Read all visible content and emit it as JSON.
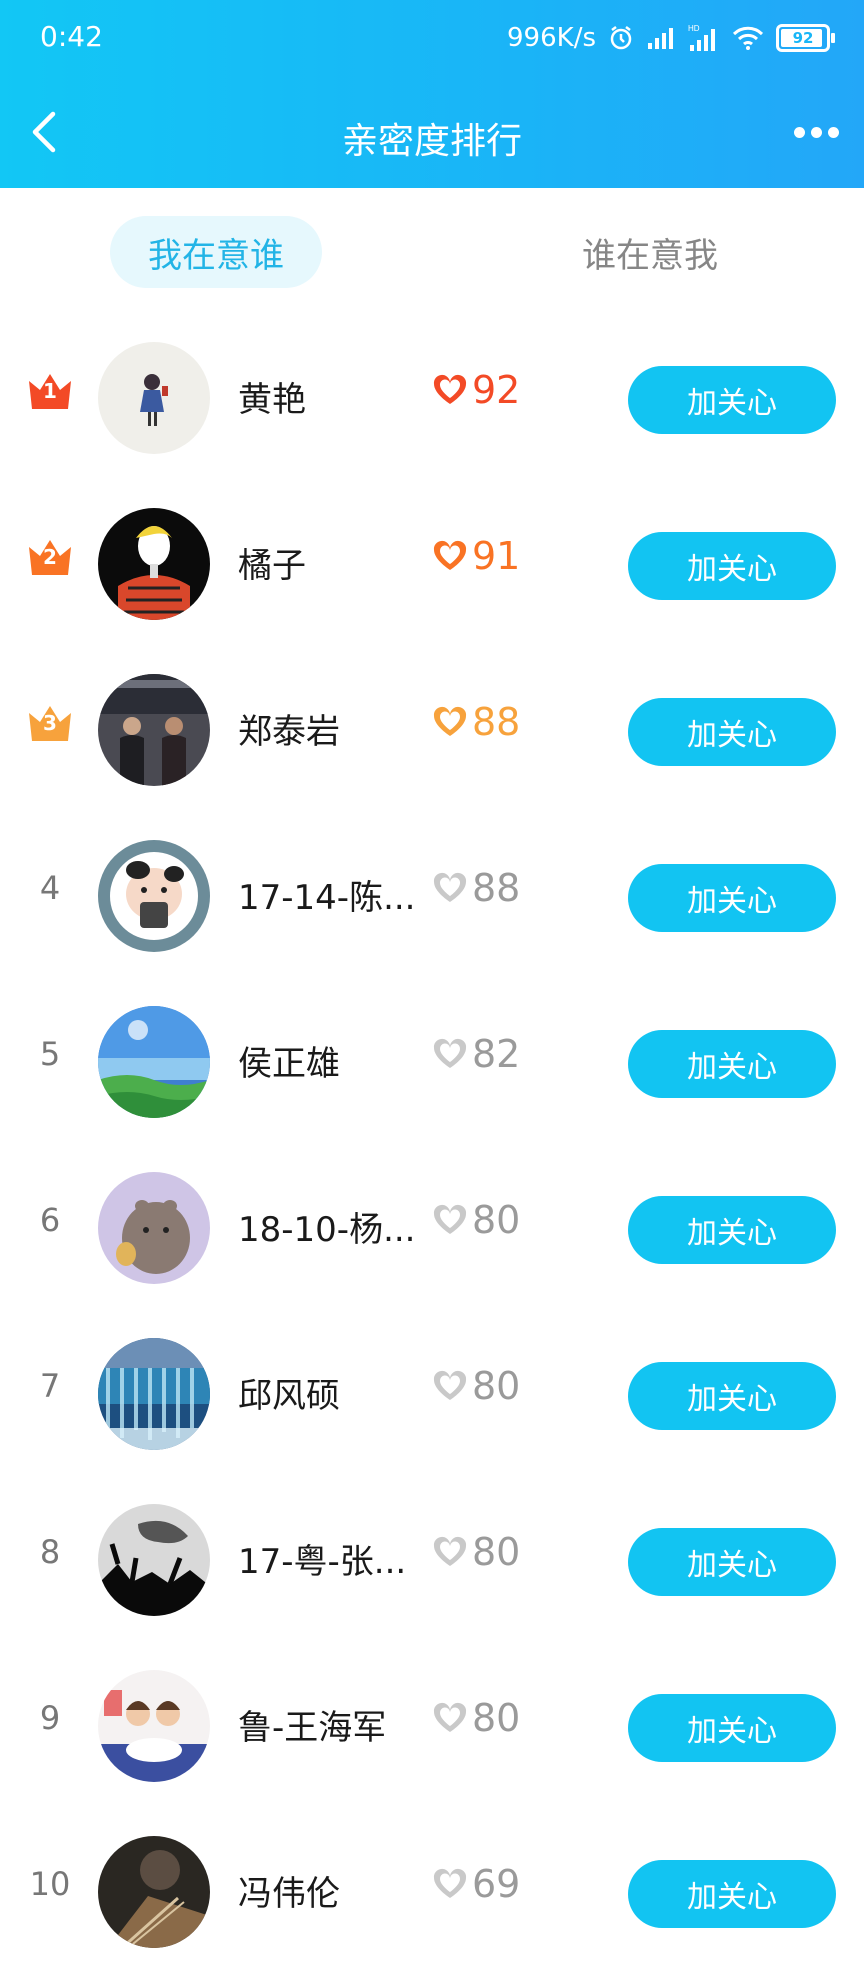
{
  "status_bar": {
    "time": "0:42",
    "net_speed": "996K/s",
    "battery": "92"
  },
  "nav": {
    "title": "亲密度排行"
  },
  "tabs": [
    {
      "label": "我在意谁",
      "active": true
    },
    {
      "label": "谁在意我",
      "active": false
    }
  ],
  "button_label": "加关心",
  "rows": [
    {
      "rank": "1",
      "name": "黄艳",
      "score": "92",
      "top": true,
      "color": "#f34a26"
    },
    {
      "rank": "2",
      "name": "橘子",
      "score": "91",
      "top": true,
      "color": "#f97324"
    },
    {
      "rank": "3",
      "name": "郑泰岩",
      "score": "88",
      "top": true,
      "color": "#f7a23c"
    },
    {
      "rank": "4",
      "name": "17-14-陈...",
      "score": "88",
      "top": false,
      "color": "#9a9a9a"
    },
    {
      "rank": "5",
      "name": "侯正雄",
      "score": "82",
      "top": false,
      "color": "#9a9a9a"
    },
    {
      "rank": "6",
      "name": "18-10-杨...",
      "score": "80",
      "top": false,
      "color": "#9a9a9a"
    },
    {
      "rank": "7",
      "name": "邱风硕",
      "score": "80",
      "top": false,
      "color": "#9a9a9a"
    },
    {
      "rank": "8",
      "name": "17-粤-张...",
      "score": "80",
      "top": false,
      "color": "#9a9a9a"
    },
    {
      "rank": "9",
      "name": "鲁-王海军",
      "score": "80",
      "top": false,
      "color": "#9a9a9a"
    },
    {
      "rank": "10",
      "name": "冯伟伦",
      "score": "69",
      "top": false,
      "color": "#9a9a9a"
    }
  ]
}
